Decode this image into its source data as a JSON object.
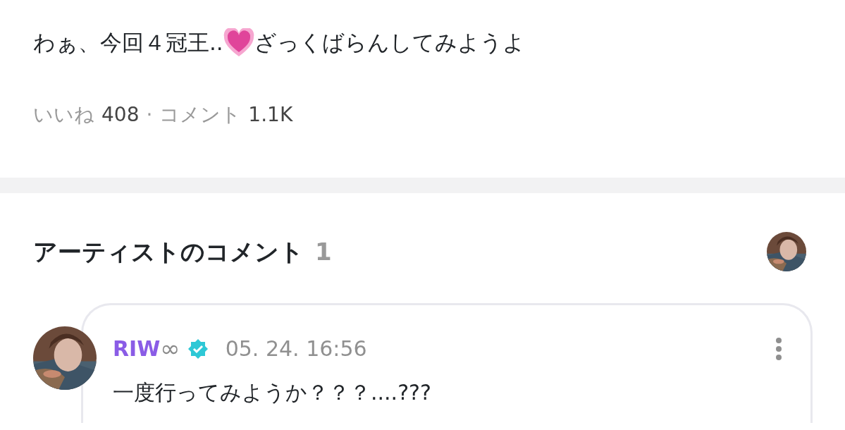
{
  "post": {
    "text_before": "わぁ、今回４冠王..",
    "text_after": "ざっくばらんしてみようよ",
    "likes_label": "いいね",
    "likes": "408",
    "separator": "·",
    "comments_label": "コメント",
    "comments": "1.1K"
  },
  "artist_comments": {
    "title": "アーティストのコメント",
    "count": "1",
    "comments": [
      {
        "name": "RIW",
        "name_suffix": "∞",
        "verified": true,
        "date": "05. 24. 16:56",
        "text": "一度行ってみようか？？？....???"
      }
    ]
  }
}
